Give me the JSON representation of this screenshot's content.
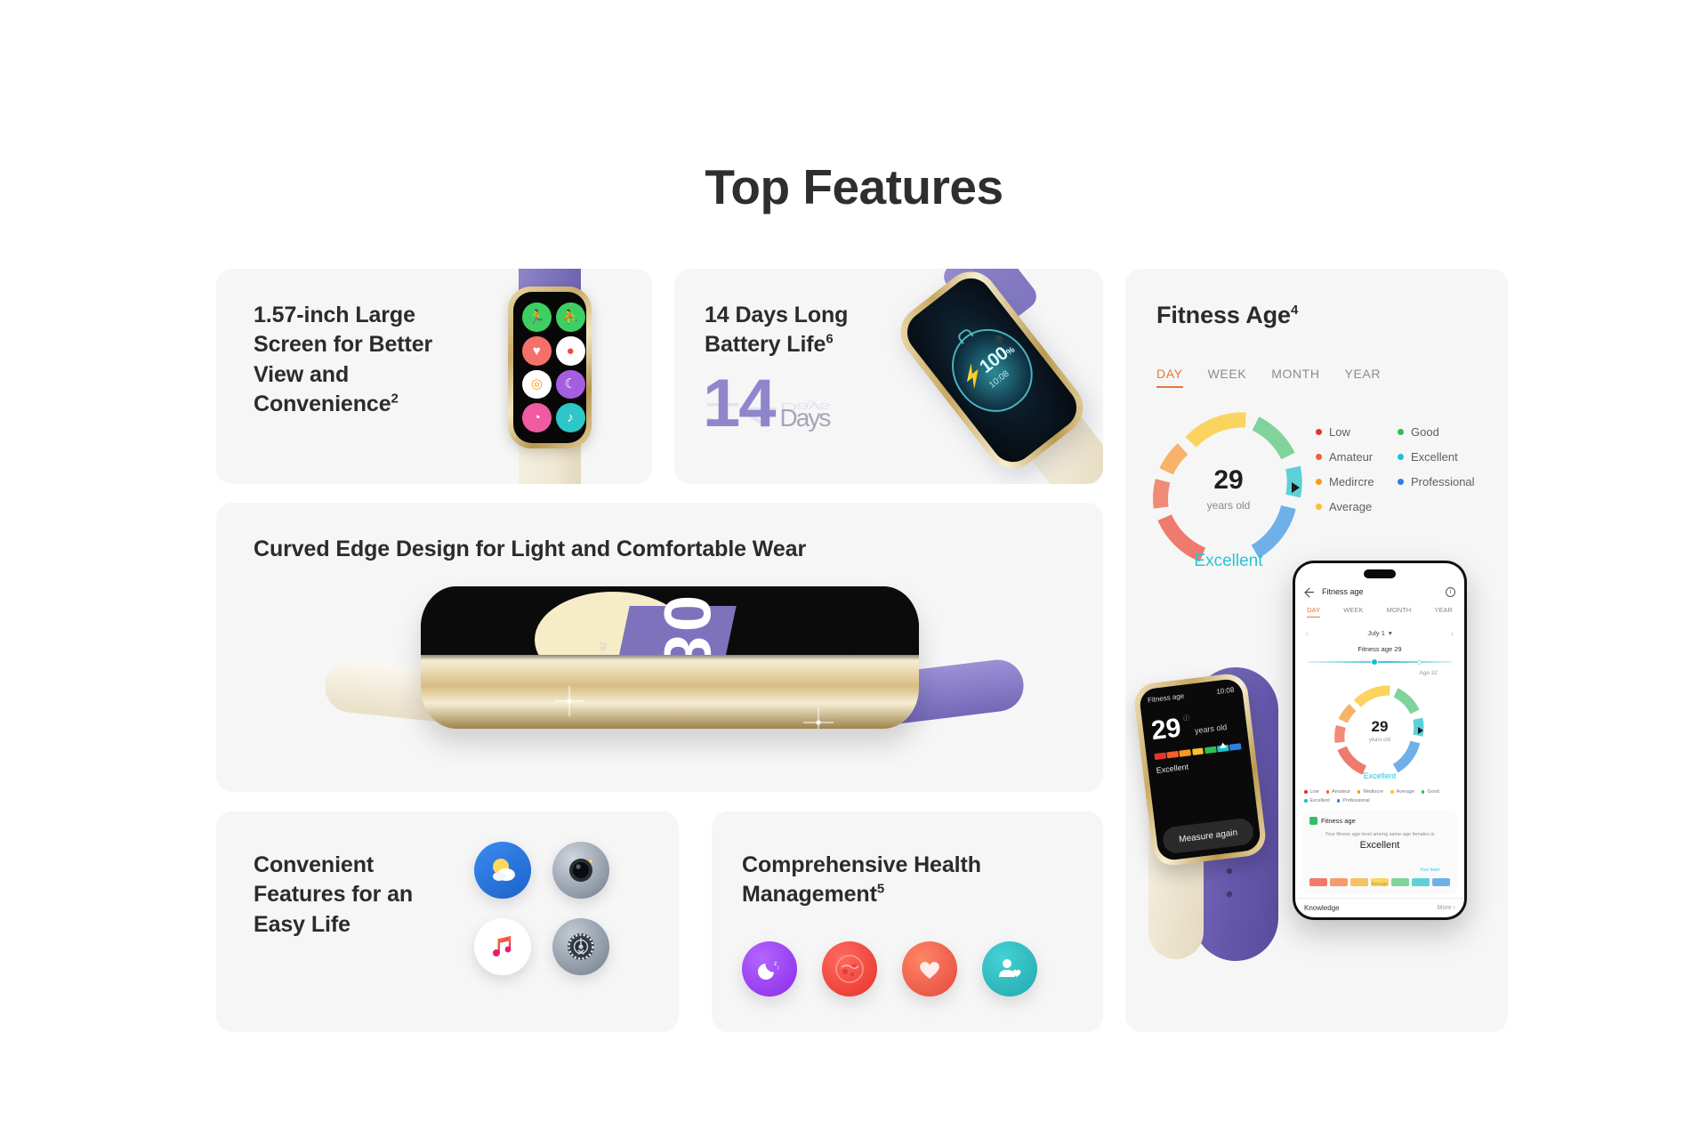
{
  "header": {
    "title": "Top Features"
  },
  "cards": {
    "screen": {
      "title": "1.57-inch Large Screen for Better View and Convenience",
      "title_sup": "2",
      "watch_apps": [
        {
          "name": "workout-icon",
          "glyph": "🏃",
          "color": "#3ecf62"
        },
        {
          "name": "body-scan-icon",
          "glyph": "⛹",
          "color": "#3ecf62"
        },
        {
          "name": "heart-rate-icon",
          "glyph": "♥",
          "color": "#f5706a"
        },
        {
          "name": "blood-oxygen-icon",
          "glyph": "●",
          "color": "#ffffff"
        },
        {
          "name": "activity-rings-icon",
          "glyph": "◎",
          "color": "#ffffff"
        },
        {
          "name": "sleep-icon",
          "glyph": "☾",
          "color": "#a45ee0"
        },
        {
          "name": "stress-icon",
          "glyph": "◔",
          "color": "#ef5aa0"
        },
        {
          "name": "music-icon",
          "glyph": "♪",
          "color": "#2ec7c7"
        }
      ]
    },
    "battery": {
      "title": "14 Days Long Battery Life",
      "title_sup": "6",
      "big_number": "14",
      "big_unit": "Days",
      "watch_percent": "100",
      "watch_percent_unit": "%",
      "watch_clock": "10:08"
    },
    "curved": {
      "title": "Curved Edge Design for Light and Comfortable Wear",
      "watch_face_digits": "08"
    },
    "convenient": {
      "title": "Convenient Features for an Easy Life",
      "icons": [
        {
          "name": "weather-icon",
          "label": "Weather",
          "color": "#2f7fe0"
        },
        {
          "name": "camera-icon",
          "label": "Camera",
          "color": "#9aa6b4"
        },
        {
          "name": "music-icon",
          "label": "Music",
          "color": "#ffffff"
        },
        {
          "name": "settings-icon",
          "label": "Settings",
          "color": "#8f99a6"
        }
      ]
    },
    "health": {
      "title": "Comprehensive Health Management",
      "title_sup": "5",
      "icons": [
        {
          "name": "sleep-monitor-icon",
          "glyph": "☾",
          "color": "#9b3ff0"
        },
        {
          "name": "blood-oxygen-icon",
          "glyph": "●",
          "color": "#f2473f"
        },
        {
          "name": "heart-rate-icon",
          "glyph": "♥",
          "color": "#f0604e"
        },
        {
          "name": "womens-health-icon",
          "glyph": "☺",
          "color": "#2bbfc4"
        }
      ]
    },
    "fitness": {
      "title": "Fitness Age",
      "title_sup": "4",
      "tabs": [
        {
          "label": "DAY",
          "active": true
        },
        {
          "label": "WEEK",
          "active": false
        },
        {
          "label": "MONTH",
          "active": false
        },
        {
          "label": "YEAR",
          "active": false
        }
      ],
      "gauge": {
        "value": "29",
        "unit": "years old",
        "rating": "Excellent",
        "rating_color": "#26c6d6"
      },
      "legend": [
        {
          "label": "Low",
          "color": "#e8322a"
        },
        {
          "label": "Good",
          "color": "#2fbf52"
        },
        {
          "label": "Amateur",
          "color": "#f2612c"
        },
        {
          "label": "Excellent",
          "color": "#1ec0cf"
        },
        {
          "label": "Medircre",
          "color": "#f59a1e"
        },
        {
          "label": "Professional",
          "color": "#2f7fe0"
        },
        {
          "label": "Average",
          "color": "#fbc02d"
        }
      ],
      "phone": {
        "header_title": "Fitness age",
        "back_icon": "back-arrow-icon",
        "info_icon": "info-icon",
        "tabs": [
          "DAY",
          "WEEK",
          "MONTH",
          "YEAR"
        ],
        "date": "July 1",
        "fitness_age_line": "Fitness age 29",
        "age_marker": "Age 32",
        "gauge_value": "29",
        "gauge_unit": "years old",
        "gauge_rating": "Excellent",
        "legend": [
          {
            "label": "Low",
            "color": "#e8322a"
          },
          {
            "label": "Amateur",
            "color": "#f2612c"
          },
          {
            "label": "Mediocre",
            "color": "#f59a1e"
          },
          {
            "label": "Average",
            "color": "#fbc02d"
          },
          {
            "label": "Good",
            "color": "#2fbf52"
          },
          {
            "label": "Excellent",
            "color": "#1ec0cf"
          },
          {
            "label": "Professional",
            "color": "#2f7fe0"
          }
        ],
        "card_title": "Fitness age",
        "card_sub": "Your fitness age level among same-age females is",
        "card_value": "Excellent",
        "your_level_label": "Your level",
        "average_label": "Average",
        "footer_left": "Knowledge",
        "footer_right": "More"
      },
      "watch": {
        "header": "Fitness age",
        "clock": "10:08",
        "age": "29",
        "age_unit": "years old",
        "rating": "Excellent",
        "button": "Measure again"
      }
    }
  },
  "gauge_segments": [
    {
      "name": "low",
      "color": "#ef7a6e"
    },
    {
      "name": "amateur",
      "color": "#f6a86a"
    },
    {
      "name": "medircre",
      "color": "#f8c766"
    },
    {
      "name": "average",
      "color": "#fbd35f"
    },
    {
      "name": "good",
      "color": "#7fd39b"
    },
    {
      "name": "excellent",
      "color": "#5ed0d8"
    },
    {
      "name": "professional",
      "color": "#6fb0e8"
    }
  ]
}
